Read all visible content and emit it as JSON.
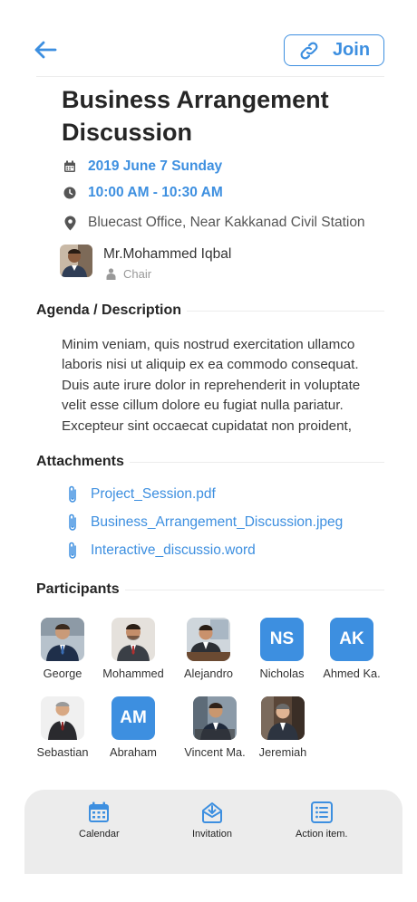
{
  "header": {
    "join_label": "Join"
  },
  "meeting": {
    "title": "Business Arrangement Discussion",
    "date": "2019 June 7 Sunday",
    "time": "10:00 AM - 10:30 AM",
    "location": "Bluecast Office, Near Kakkanad Civil Station",
    "chair_name": "Mr.Mohammed Iqbal",
    "chair_role": "Chair"
  },
  "agenda": {
    "heading": "Agenda / Description",
    "text": "Minim veniam, quis nostrud exercitation ullamco laboris nisi ut aliquip ex ea commodo consequat. Duis aute irure dolor in reprehenderit in voluptate velit esse cillum dolore eu fugiat nulla pariatur. Excepteur sint occaecat cupidatat non proident,"
  },
  "attachments": {
    "heading": "Attachments",
    "files": [
      "Project_Session.pdf",
      "Business_Arrangement_Discussion.jpeg",
      "Interactive_discussio.word"
    ]
  },
  "participants": {
    "heading": "Participants",
    "people": [
      {
        "name": "George",
        "initials": ""
      },
      {
        "name": "Mohammed",
        "initials": ""
      },
      {
        "name": "Alejandro",
        "initials": ""
      },
      {
        "name": "Nicholas",
        "initials": "NS"
      },
      {
        "name": "Ahmed Ka.",
        "initials": "AK"
      },
      {
        "name": "Sebastian",
        "initials": ""
      },
      {
        "name": "Abraham",
        "initials": "AM"
      },
      {
        "name": "Vincent Ma.",
        "initials": ""
      },
      {
        "name": "Jeremiah",
        "initials": ""
      }
    ]
  },
  "bottom_nav": {
    "calendar": "Calendar",
    "invitation": "Invitation",
    "action_items": "Action item."
  },
  "colors": {
    "accent": "#3d8fe0",
    "nav_bg": "#ececec"
  }
}
